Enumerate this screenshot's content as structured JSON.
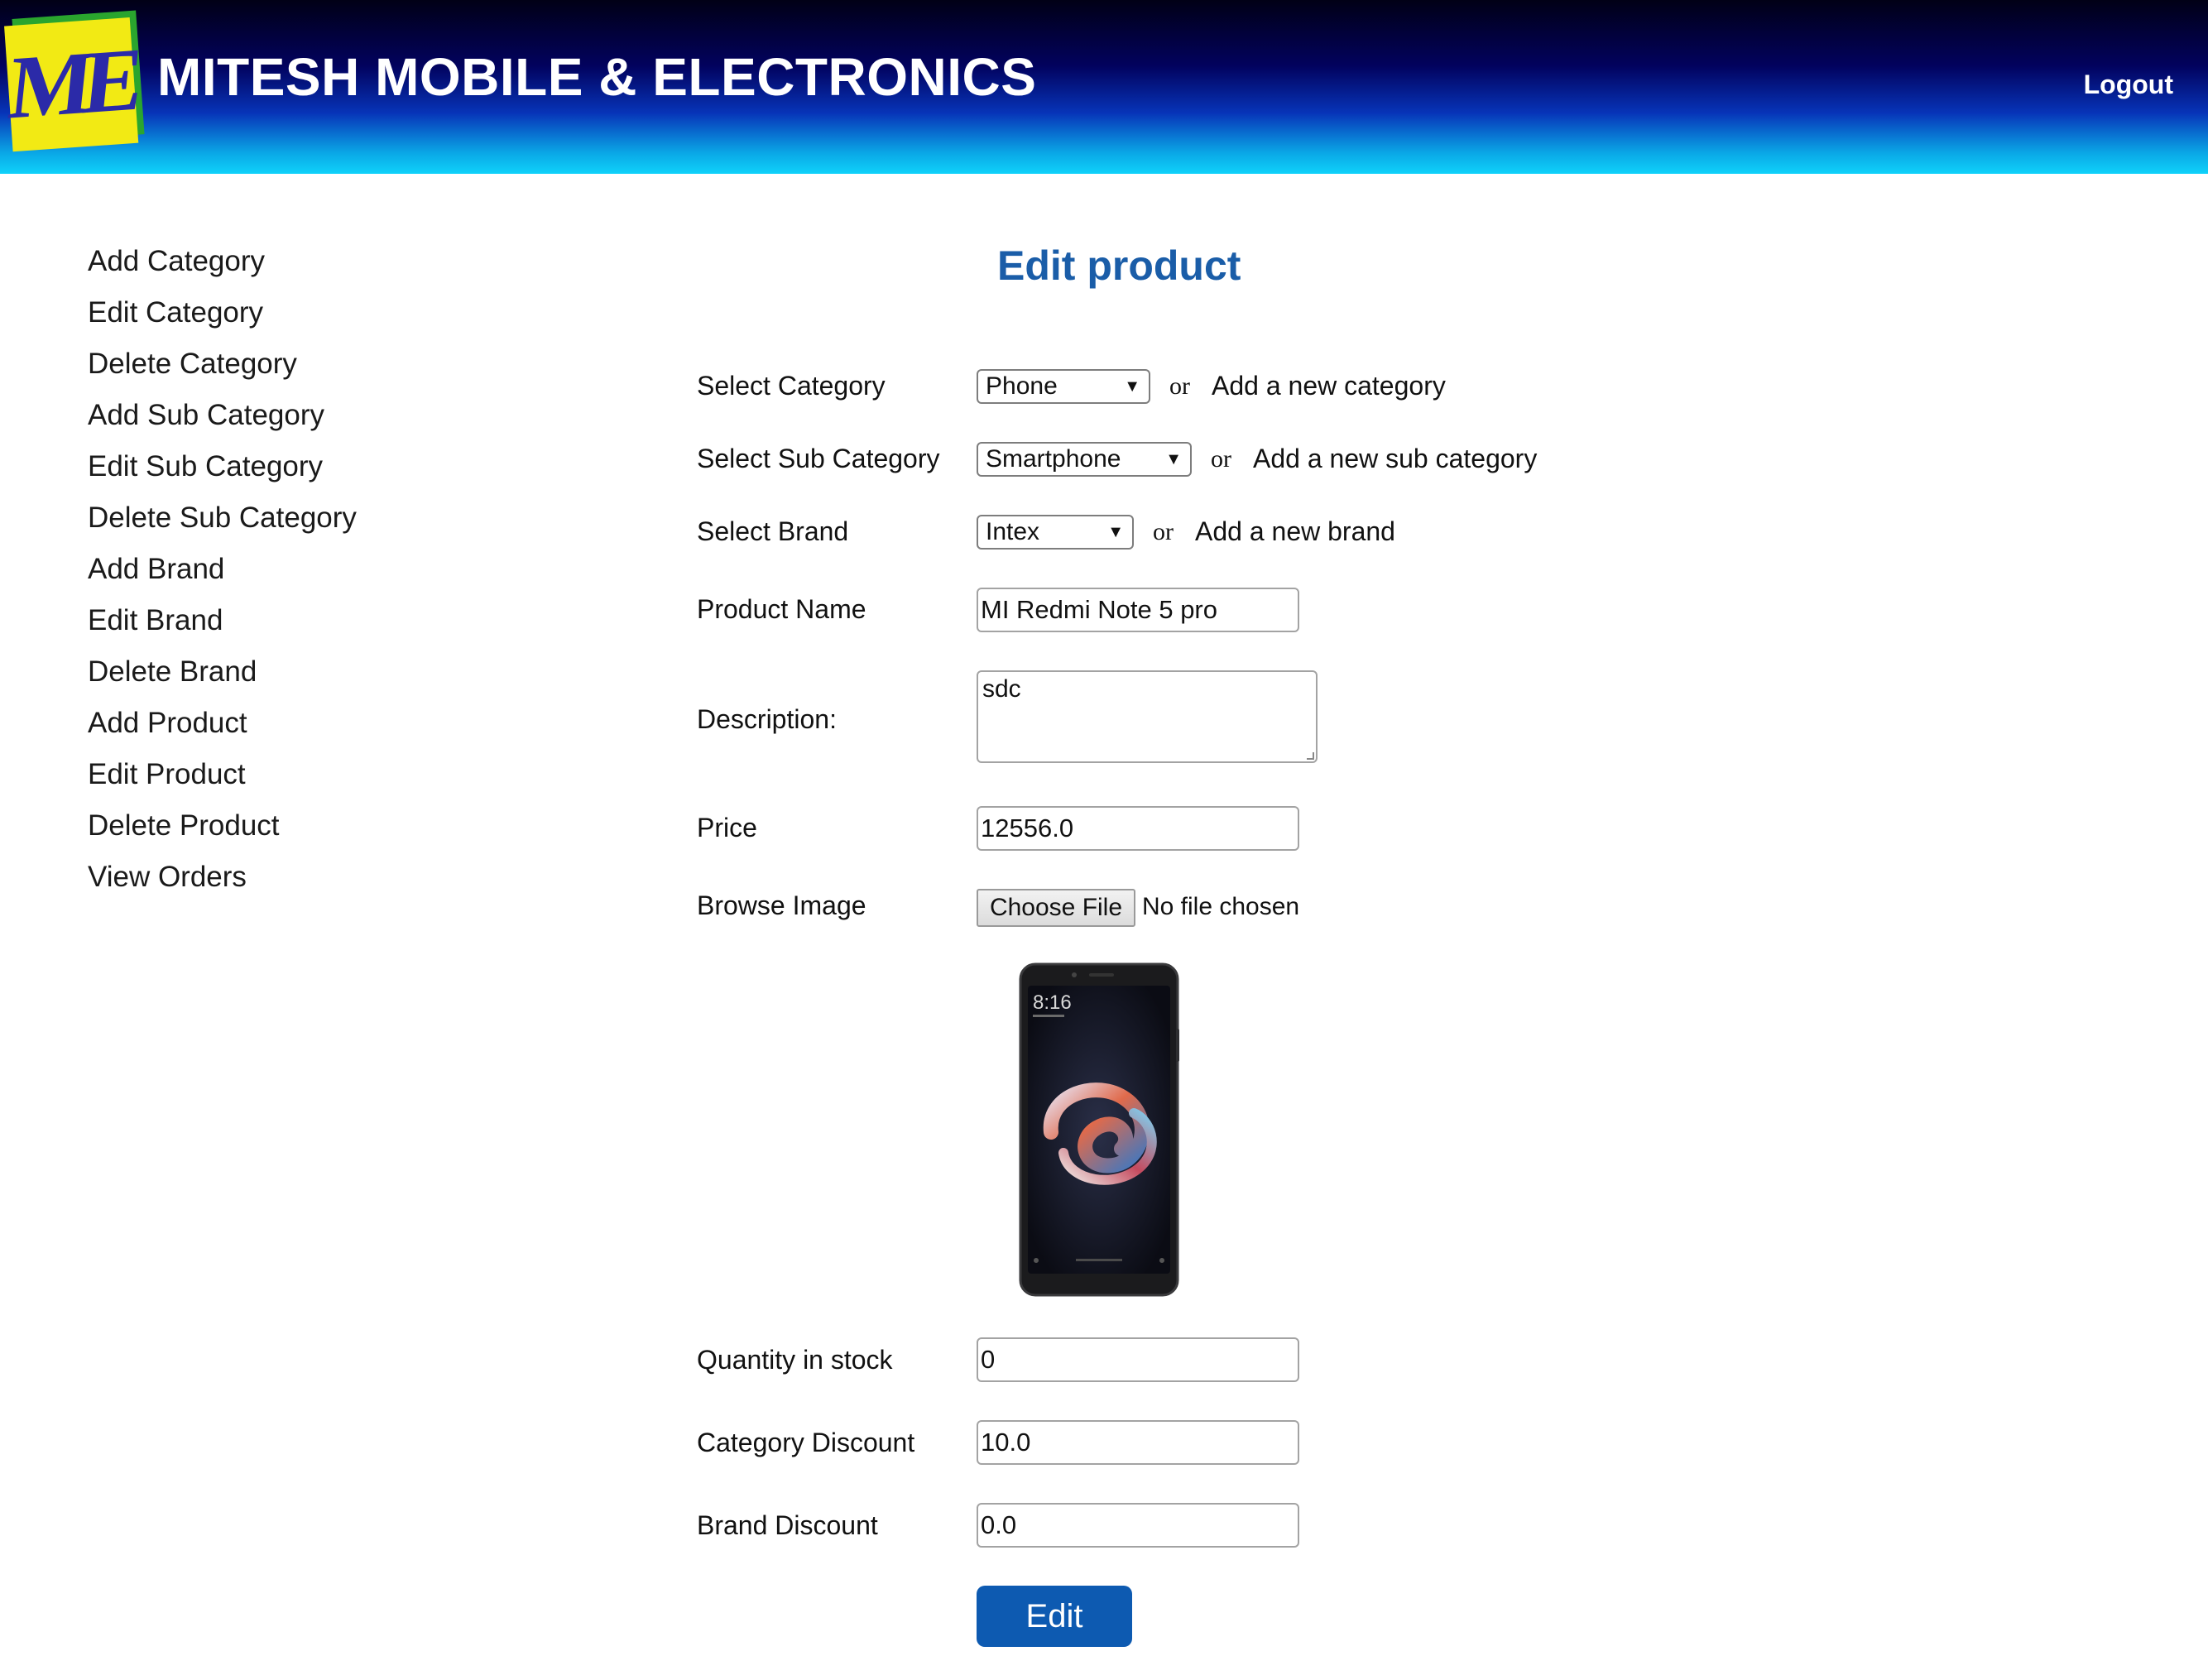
{
  "header": {
    "logo_text": "ME",
    "title": "MITESH MOBILE & ELECTRONICS",
    "logout_label": "Logout"
  },
  "sidebar": {
    "items": [
      {
        "label": "Add Category"
      },
      {
        "label": "Edit Category"
      },
      {
        "label": "Delete Category"
      },
      {
        "label": "Add Sub Category"
      },
      {
        "label": "Edit Sub Category"
      },
      {
        "label": "Delete Sub Category"
      },
      {
        "label": "Add Brand"
      },
      {
        "label": "Edit Brand"
      },
      {
        "label": "Delete Brand"
      },
      {
        "label": "Add Product"
      },
      {
        "label": "Edit Product"
      },
      {
        "label": "Delete Product"
      },
      {
        "label": "View Orders"
      }
    ]
  },
  "form": {
    "title": "Edit product",
    "or_text": "or",
    "category": {
      "label": "Select Category",
      "selected": "Phone",
      "add_link": "Add a new category"
    },
    "sub_category": {
      "label": "Select Sub Category",
      "selected": "Smartphone",
      "add_link": "Add a new sub category"
    },
    "brand": {
      "label": "Select Brand",
      "selected": "Intex",
      "add_link": "Add a new brand"
    },
    "product_name": {
      "label": "Product Name",
      "value": "MI Redmi Note 5 pro"
    },
    "description": {
      "label": "Description:",
      "value": "sdc"
    },
    "price": {
      "label": "Price",
      "value": "12556.0"
    },
    "image": {
      "label": "Browse Image",
      "button": "Choose File",
      "status": "No file chosen",
      "phone_time": "8:16"
    },
    "quantity": {
      "label": "Quantity in stock",
      "value": "0"
    },
    "category_discount": {
      "label": "Category Discount",
      "value": "10.0"
    },
    "brand_discount": {
      "label": "Brand Discount",
      "value": "0.0"
    },
    "submit_label": "Edit"
  },
  "colors": {
    "title_blue": "#1a5da8",
    "button_blue": "#0d5ab1",
    "header_dark": "#02025e",
    "header_light": "#0fd2fa",
    "logo_yellow": "#f2ea14",
    "logo_green": "#2aa52e"
  }
}
